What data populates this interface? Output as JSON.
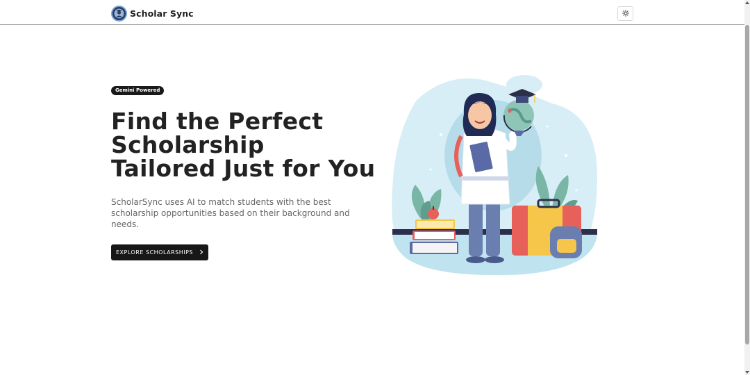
{
  "header": {
    "brand_name": "Scholar Sync",
    "logo_icon": "graduate-avatar-icon",
    "theme_toggle_icon": "sun-icon"
  },
  "hero": {
    "badge": "Gemini Powered",
    "headline_lines": [
      "Find the Perfect",
      "Scholarship",
      "Tailored Just for You"
    ],
    "description": "ScholarSync uses AI to match students with the best scholarship opportunities based on their background and needs.",
    "cta_label": "EXPLORE SCHOLARSHIPS",
    "cta_icon": "chevron-right-icon"
  },
  "illustration": {
    "subject": "student-with-globe-and-books-illustration"
  },
  "colors": {
    "accent": "#171717",
    "blob": "#d7eef6",
    "badge_bg": "#1a1a1a"
  }
}
